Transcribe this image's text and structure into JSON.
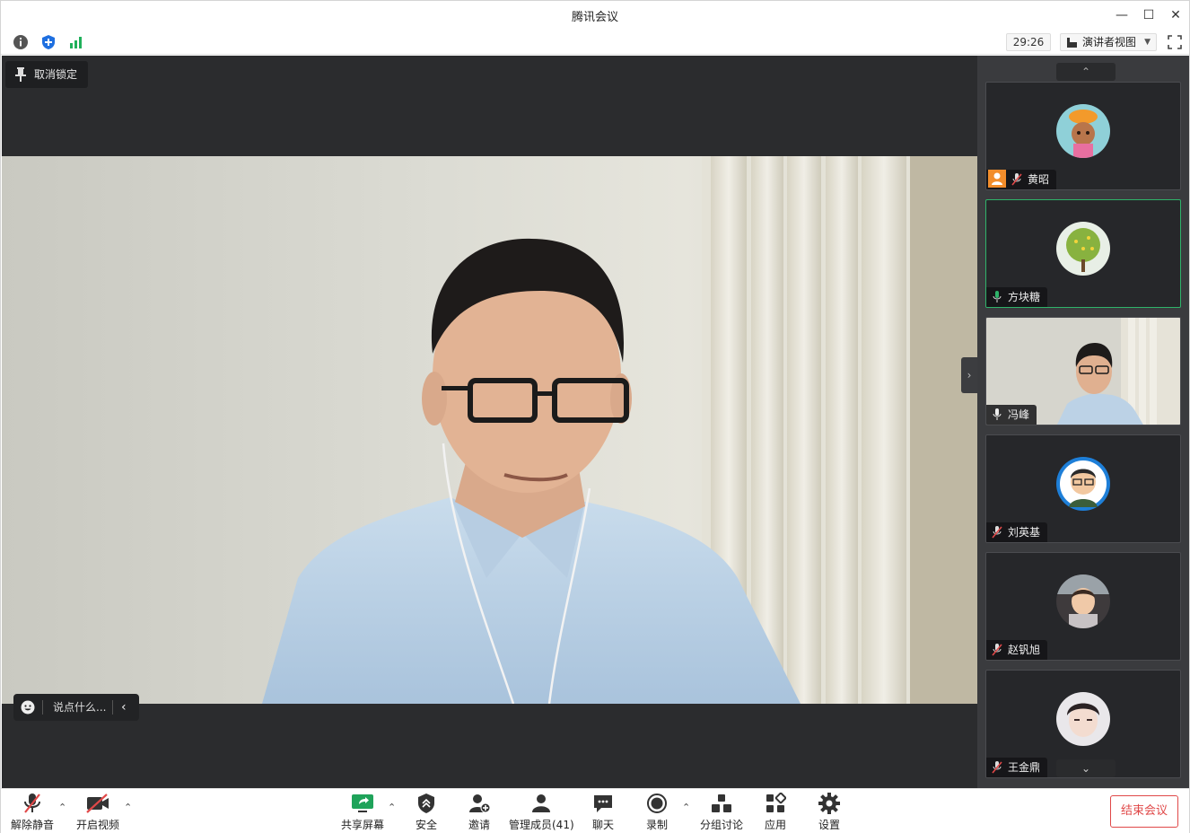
{
  "window": {
    "title": "腾讯会议"
  },
  "infobar": {
    "timer": "29:26",
    "view_mode": "演讲者视图"
  },
  "main": {
    "unpin_label": "取消锁定",
    "chat_placeholder": "说点什么..."
  },
  "participants": [
    {
      "name": "黄昭",
      "avatar": "cartoon-girl-avatar",
      "muted": true,
      "host_badge": true
    },
    {
      "name": "方块糖",
      "avatar": "tree-avatar",
      "muted": false,
      "speaking": true
    },
    {
      "name": "冯峰",
      "avatar": "video-thumbnail",
      "muted": false
    },
    {
      "name": "刘英基",
      "avatar": "cartoon-man-avatar",
      "muted": true
    },
    {
      "name": "赵钒旭",
      "avatar": "child-photo-avatar",
      "muted": true
    },
    {
      "name": "王金鼎",
      "avatar": "child-photo-avatar",
      "muted": true
    }
  ],
  "toolbar": {
    "unmute": "解除静音",
    "start_video": "开启视频",
    "share_screen": "共享屏幕",
    "security": "安全",
    "invite": "邀请",
    "manage_members": "管理成员(41)",
    "chat": "聊天",
    "record": "录制",
    "breakout": "分组讨论",
    "apps": "应用",
    "settings": "设置",
    "end_meeting": "结束会议"
  },
  "colors": {
    "accent_green": "#2fb36a",
    "end_red": "#e04848",
    "host_orange": "#f28d2b",
    "security_blue": "#1e6fe0"
  }
}
